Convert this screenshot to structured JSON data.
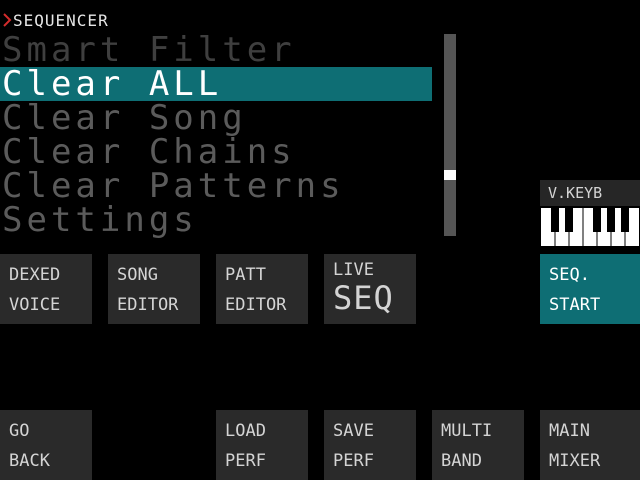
{
  "header": {
    "title": "SEQUENCER",
    "chevron_color": "#d42c2c"
  },
  "menu": {
    "items": [
      {
        "label": "Smart Filter",
        "state": "faded"
      },
      {
        "label": "Clear ALL",
        "state": "selected"
      },
      {
        "label": "Clear Song",
        "state": "normal"
      },
      {
        "label": "Clear Chains",
        "state": "normal"
      },
      {
        "label": "Clear Patterns",
        "state": "normal"
      },
      {
        "label": "Settings",
        "state": "normal"
      }
    ]
  },
  "vkeyb": {
    "label": "V.KEYB"
  },
  "buttons_top": {
    "dexed_voice": {
      "line1": "DEXED",
      "line2": "VOICE"
    },
    "song_editor": {
      "line1": "SONG",
      "line2": "EDITOR"
    },
    "patt_editor": {
      "line1": "PATT",
      "line2": "EDITOR"
    },
    "live_seq": {
      "line1": "LIVE",
      "line2": "SEQ"
    },
    "seq_start": {
      "line1": "SEQ.",
      "line2": "START"
    }
  },
  "buttons_bottom": {
    "go_back": {
      "line1": "GO",
      "line2": "BACK"
    },
    "load_perf": {
      "line1": "LOAD",
      "line2": "PERF"
    },
    "save_perf": {
      "line1": "SAVE",
      "line2": "PERF"
    },
    "multi_band": {
      "line1": "MULTI",
      "line2": "BAND"
    },
    "main_mixer": {
      "line1": "MAIN",
      "line2": "MIXER"
    }
  },
  "colors": {
    "accent": "#0e6e74",
    "button_bg": "#2a2a2a",
    "background": "#000000"
  }
}
